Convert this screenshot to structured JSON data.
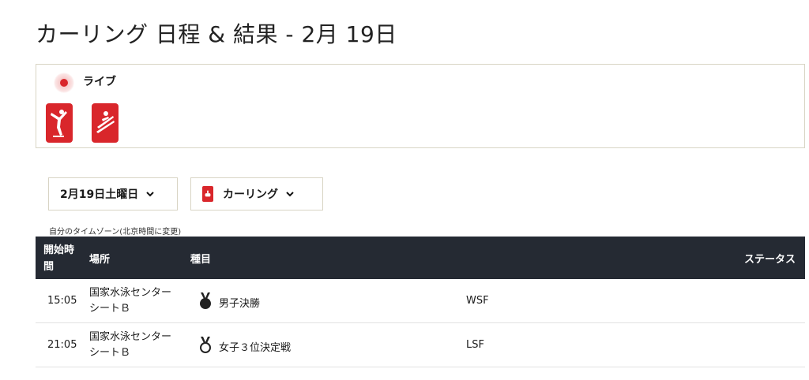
{
  "page": {
    "title": "カーリング 日程 & 結果 - 2月 19日"
  },
  "live": {
    "label": "ライブ",
    "sports": [
      {
        "icon": "figure-skating-icon"
      },
      {
        "icon": "ski-jumping-icon"
      }
    ]
  },
  "filters": {
    "date_label": "2月19日土曜日",
    "sport_label": "カーリング"
  },
  "timezone_note": "自分のタイムゾーン(北京時間に変更)",
  "table": {
    "headers": {
      "time": "開始時間",
      "venue": "場所",
      "event": "種目",
      "status": "ステータス"
    },
    "rows": [
      {
        "time": "15:05",
        "venue": "国家水泳センター シートＢ",
        "medal": "gold-medal-icon",
        "event": "男子決勝",
        "code": "WSF"
      },
      {
        "time": "21:05",
        "venue": "国家水泳センター シートＢ",
        "medal": "bronze-medal-icon",
        "event": "女子３位決定戦",
        "code": "LSF"
      }
    ]
  },
  "colors": {
    "accent": "#d9262b",
    "header_bg": "#252a33"
  }
}
